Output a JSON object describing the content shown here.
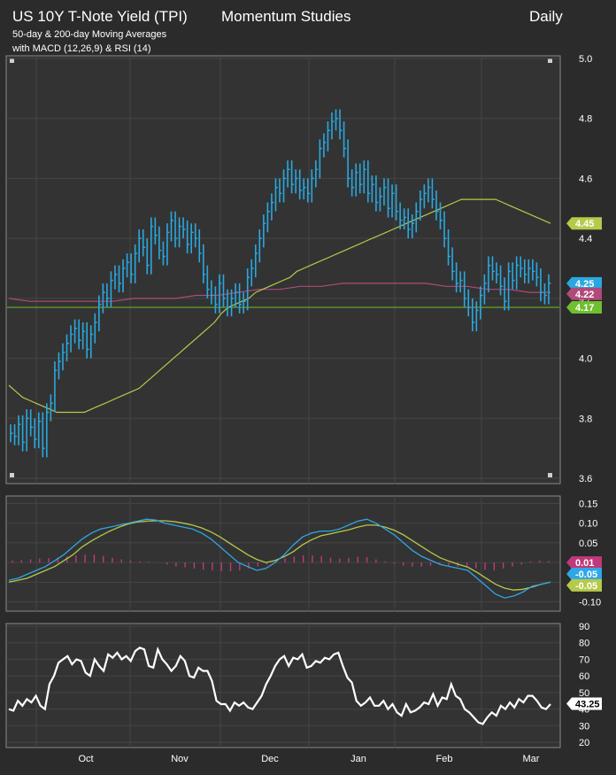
{
  "header": {
    "title": "US 10Y T-Note Yield (TPI)",
    "study": "Momentum Studies",
    "period": "Daily",
    "sub1": "50-day & 200-day Moving Averages",
    "sub2": "with MACD (12,26,9) & RSI (14)"
  },
  "colors": {
    "background": "#2b2b2b",
    "plot_bg": "#333333",
    "price": "#29a8e0",
    "ma50": "#b5c94a",
    "ma200": "#b04a7a",
    "ref_line": "#6fbf2e",
    "macd": "#2fa6e6",
    "signal": "#b5c94a",
    "hist": "#c0397a",
    "rsi": "#ffffff"
  },
  "chart_data": [
    {
      "type": "line",
      "name": "price-panel",
      "y_ticks": [
        "5.0",
        "4.8",
        "4.6",
        "4.4",
        "4.2",
        "4.0",
        "3.8",
        "3.6"
      ],
      "ylim": [
        3.6,
        5.0
      ],
      "x_ticks": [
        "Oct",
        "Nov",
        "Dec",
        "Jan",
        "Feb",
        "Mar"
      ],
      "price_close": [
        3.75,
        3.74,
        3.78,
        3.72,
        3.8,
        3.77,
        3.73,
        3.79,
        3.7,
        3.82,
        3.85,
        3.96,
        3.99,
        4.02,
        4.05,
        4.08,
        4.1,
        4.06,
        4.09,
        4.03,
        4.08,
        4.12,
        4.18,
        4.22,
        4.2,
        4.26,
        4.28,
        4.25,
        4.3,
        4.32,
        4.28,
        4.35,
        4.4,
        4.37,
        4.31,
        4.44,
        4.41,
        4.36,
        4.34,
        4.42,
        4.46,
        4.4,
        4.44,
        4.43,
        4.38,
        4.42,
        4.4,
        4.35,
        4.28,
        4.23,
        4.21,
        4.18,
        4.25,
        4.2,
        4.17,
        4.2,
        4.22,
        4.18,
        4.19,
        4.27,
        4.3,
        4.35,
        4.4,
        4.45,
        4.49,
        4.52,
        4.57,
        4.55,
        4.6,
        4.63,
        4.58,
        4.6,
        4.56,
        4.57,
        4.55,
        4.6,
        4.63,
        4.7,
        4.72,
        4.76,
        4.79,
        4.8,
        4.76,
        4.7,
        4.6,
        4.57,
        4.62,
        4.58,
        4.63,
        4.55,
        4.58,
        4.52,
        4.54,
        4.57,
        4.5,
        4.55,
        4.49,
        4.46,
        4.47,
        4.43,
        4.45,
        4.49,
        4.53,
        4.55,
        4.57,
        4.53,
        4.49,
        4.46,
        4.4,
        4.34,
        4.29,
        4.25,
        4.26,
        4.2,
        4.17,
        4.12,
        4.16,
        4.21,
        4.25,
        4.31,
        4.29,
        4.28,
        4.24,
        4.19,
        4.29,
        4.26,
        4.31,
        4.3,
        4.28,
        4.3,
        4.29,
        4.27,
        4.22,
        4.21,
        4.25
      ],
      "ma50": [
        3.91,
        3.89,
        3.87,
        3.86,
        3.85,
        3.84,
        3.83,
        3.82,
        3.82,
        3.82,
        3.82,
        3.82,
        3.83,
        3.84,
        3.85,
        3.86,
        3.87,
        3.88,
        3.89,
        3.9,
        3.92,
        3.94,
        3.96,
        3.98,
        4.0,
        4.02,
        4.04,
        4.06,
        4.08,
        4.1,
        4.12,
        4.15,
        4.17,
        4.18,
        4.19,
        4.2,
        4.22,
        4.23,
        4.24,
        4.25,
        4.26,
        4.27,
        4.29,
        4.3,
        4.31,
        4.32,
        4.33,
        4.34,
        4.35,
        4.36,
        4.37,
        4.38,
        4.39,
        4.4,
        4.41,
        4.42,
        4.43,
        4.44,
        4.45,
        4.46,
        4.47,
        4.48,
        4.49,
        4.5,
        4.51,
        4.52,
        4.53,
        4.53,
        4.53,
        4.53,
        4.53,
        4.53,
        4.52,
        4.51,
        4.5,
        4.49,
        4.48,
        4.47,
        4.46,
        4.45
      ],
      "ma200": [
        4.2,
        4.19,
        4.19,
        4.19,
        4.19,
        4.19,
        4.2,
        4.2,
        4.2,
        4.21,
        4.21,
        4.22,
        4.23,
        4.23,
        4.24,
        4.24,
        4.25,
        4.25,
        4.25,
        4.25,
        4.25,
        4.24,
        4.24,
        4.23,
        4.23,
        4.22,
        4.22
      ],
      "reference_level": 4.17,
      "labels": [
        {
          "text": "4.45",
          "color": "#b5c94a",
          "y": 4.45
        },
        {
          "text": "4.25",
          "color": "#29a8e0",
          "y": 4.25
        },
        {
          "text": "4.22",
          "color": "#b04a7a",
          "y": 4.215
        },
        {
          "text": "4.17",
          "color": "#6fbf2e",
          "y": 4.17
        }
      ]
    },
    {
      "type": "line",
      "name": "macd-panel",
      "y_ticks": [
        "0.15",
        "0.10",
        "0.05",
        "0.00",
        "-0.05",
        "-0.10"
      ],
      "ylim": [
        -0.11,
        0.16
      ],
      "macd": [
        -0.045,
        -0.04,
        -0.03,
        -0.02,
        -0.01,
        0.005,
        0.02,
        0.04,
        0.06,
        0.075,
        0.085,
        0.09,
        0.095,
        0.1,
        0.105,
        0.11,
        0.108,
        0.1,
        0.095,
        0.09,
        0.085,
        0.075,
        0.06,
        0.04,
        0.02,
        0.0,
        -0.01,
        -0.02,
        -0.015,
        0.0,
        0.02,
        0.045,
        0.065,
        0.075,
        0.08,
        0.08,
        0.085,
        0.095,
        0.105,
        0.11,
        0.1,
        0.085,
        0.07,
        0.05,
        0.03,
        0.015,
        0.005,
        -0.005,
        -0.01,
        -0.015,
        -0.02,
        -0.04,
        -0.06,
        -0.08,
        -0.09,
        -0.085,
        -0.075,
        -0.06,
        -0.055,
        -0.05
      ],
      "signal": [
        -0.05,
        -0.045,
        -0.04,
        -0.03,
        -0.02,
        -0.01,
        0.005,
        0.02,
        0.04,
        0.055,
        0.068,
        0.08,
        0.09,
        0.098,
        0.103,
        0.105,
        0.106,
        0.106,
        0.104,
        0.1,
        0.095,
        0.088,
        0.078,
        0.065,
        0.05,
        0.035,
        0.02,
        0.008,
        0.0,
        0.005,
        0.015,
        0.028,
        0.045,
        0.058,
        0.068,
        0.073,
        0.078,
        0.083,
        0.09,
        0.095,
        0.095,
        0.09,
        0.082,
        0.07,
        0.055,
        0.04,
        0.025,
        0.012,
        0.003,
        -0.005,
        -0.012,
        -0.025,
        -0.04,
        -0.055,
        -0.065,
        -0.07,
        -0.068,
        -0.062,
        -0.055,
        -0.05
      ],
      "histogram": [
        0.005,
        0.006,
        0.008,
        0.01,
        0.011,
        0.013,
        0.015,
        0.018,
        0.02,
        0.02,
        0.017,
        0.012,
        0.008,
        0.005,
        0.003,
        0.002,
        0.001,
        -0.005,
        -0.01,
        -0.012,
        -0.015,
        -0.018,
        -0.02,
        -0.022,
        -0.022,
        -0.02,
        -0.015,
        -0.01,
        -0.005,
        0.005,
        0.01,
        0.015,
        0.018,
        0.018,
        0.016,
        0.012,
        0.01,
        0.012,
        0.015,
        0.014,
        0.008,
        0.003,
        -0.003,
        -0.008,
        -0.01,
        -0.01,
        -0.008,
        -0.006,
        -0.008,
        -0.01,
        -0.012,
        -0.015,
        -0.018,
        -0.02,
        -0.015,
        -0.01,
        -0.005,
        0.003,
        0.005,
        0.004
      ],
      "labels": [
        {
          "text": "0.01",
          "color": "#c0397a",
          "y": 0.0
        },
        {
          "text": "-0.05",
          "color": "#2fa6e6",
          "y": -0.029
        },
        {
          "text": "-0.05",
          "color": "#b5c94a",
          "y": -0.058
        }
      ]
    },
    {
      "type": "line",
      "name": "rsi-panel",
      "y_ticks": [
        "90",
        "80",
        "70",
        "60",
        "50",
        "40",
        "30",
        "20"
      ],
      "ylim": [
        20,
        90
      ],
      "rsi": [
        40,
        39,
        45,
        42,
        46,
        44,
        48,
        42,
        40,
        55,
        60,
        68,
        70,
        72,
        67,
        70,
        69,
        62,
        60,
        70,
        66,
        63,
        73,
        71,
        74,
        70,
        72,
        69,
        75,
        77,
        76,
        66,
        65,
        76,
        70,
        67,
        63,
        66,
        72,
        69,
        60,
        59,
        65,
        63,
        63,
        57,
        45,
        43,
        43,
        39,
        44,
        42,
        44,
        41,
        40,
        44,
        48,
        55,
        60,
        66,
        70,
        72,
        66,
        71,
        70,
        73,
        65,
        66,
        69,
        68,
        71,
        70,
        73,
        74,
        66,
        59,
        56,
        45,
        42,
        44,
        47,
        42,
        42,
        45,
        40,
        43,
        38,
        36,
        43,
        38,
        39,
        41,
        44,
        43,
        49,
        42,
        47,
        46,
        55,
        48,
        46,
        40,
        38,
        35,
        32,
        31,
        35,
        38,
        36,
        42,
        40,
        44,
        41,
        46,
        44,
        48,
        48,
        45,
        41,
        40,
        43
      ],
      "labels": [
        {
          "text": "43.25",
          "color": "#ffffff",
          "y": 43.25
        }
      ]
    }
  ]
}
